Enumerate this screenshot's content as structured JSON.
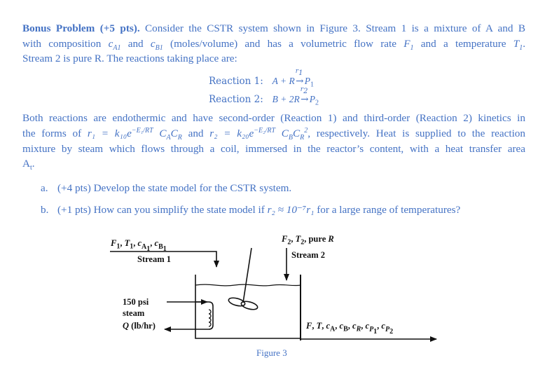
{
  "problem": {
    "title": "Bonus Problem (+5 pts).",
    "intro_line1_rest": " Consider the CSTR system shown in Figure 3. Stream 1 is a mixture of A and B",
    "intro_line2_a": "with composition ",
    "cA1": "c",
    "cA1_sub": "A1",
    "intro_line2_b": " and ",
    "cB1": "c",
    "cB1_sub": "B1",
    "intro_line2_c": " (moles/volume) and has a volumetric flow rate ",
    "F1": "F",
    "F1_sub": "1",
    "intro_line2_d": " and a temperature ",
    "T1": "T",
    "T1_sub": "1",
    "intro_line2_e": ".",
    "intro_line3": "Stream 2 is pure R. The reactions taking place are:"
  },
  "reactions": [
    {
      "label": "Reaction 1:",
      "lhs": "A + R",
      "rate": "r1",
      "product": "P",
      "product_sub": "1"
    },
    {
      "label": "Reaction 2:",
      "lhs": "B + 2R",
      "rate": "r2",
      "product": "P",
      "product_sub": "2"
    }
  ],
  "kinetics": {
    "line1": "Both reactions are endothermic and have second-order (Reaction 1) and third-order (Reaction 2) kinetics in",
    "line2_a": "the forms of ",
    "r1_expr": "r₁ = k₁₀e",
    "r1_exp": "−E₁/RT",
    "r1_tail": "C_A C_R",
    "line2_b": " and ",
    "r2_expr": "r₂ = k₂₀e",
    "r2_exp": "−E₂/RT",
    "r2_tail": "C_B C_R²",
    "line2_c": ", respectively. Heat is supplied to the reaction",
    "line3": "mixture by steam which flows through a coil, immersed in the reactor’s content, with a heat transfer area",
    "line4": "A",
    "line4_sub": "t",
    "line4_end": "."
  },
  "questions": [
    {
      "label": "a.",
      "text": "(+4 pts) Develop the state model for the CSTR system."
    },
    {
      "label": "b.",
      "text_a": "(+1 pts) How can you simplify the state model if ",
      "cond": "r₂ ≈ 10⁻⁷r₁",
      "text_b": " for a large range of temperatures?"
    }
  ],
  "figure": {
    "stream1_vars": "F₁, T₁, c",
    "stream1_label": "Stream 1",
    "stream2_vars": "F₂, T₂, pure R",
    "stream2_label": "Stream 2",
    "steam_line1": "150 psi",
    "steam_line2": "steam",
    "steam_line3": "Q (lb/hr)",
    "outlet_vars": "F, T, c_A, c_B, c_R, c_P1, c_P2",
    "caption": "Figure 3"
  },
  "colors": {
    "text": "#4472C4",
    "figure_ink": "#111111"
  }
}
